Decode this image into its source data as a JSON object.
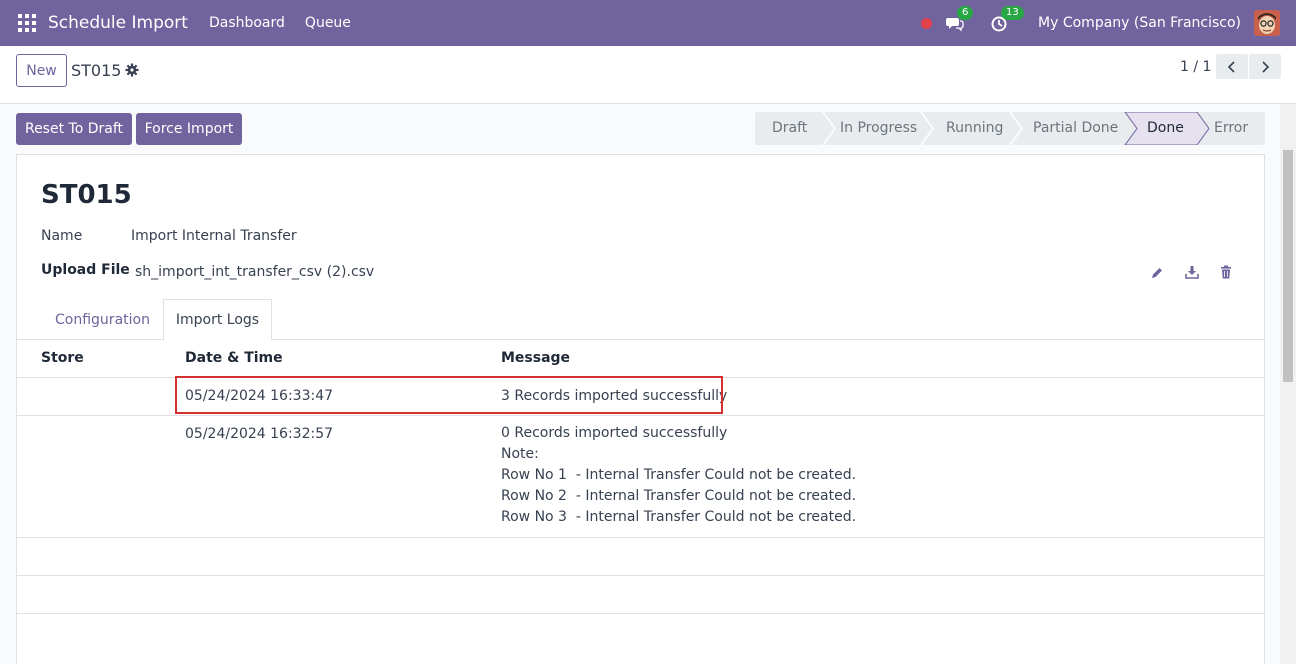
{
  "navbar": {
    "app_title": "Schedule Import",
    "links": [
      "Dashboard",
      "Queue"
    ],
    "messages_count": "6",
    "activities_count": "13",
    "company": "My Company (San Francisco)",
    "color": "#71639e"
  },
  "control": {
    "new_label": "New",
    "record_name": "ST015",
    "pager": "1 / 1"
  },
  "actions": {
    "reset_label": "Reset To Draft",
    "force_label": "Force Import"
  },
  "statusbar": {
    "steps": [
      "Draft",
      "In Progress",
      "Running",
      "Partial Done",
      "Done",
      "Error"
    ],
    "active": "Done"
  },
  "form": {
    "title": "ST015",
    "name_label": "Name",
    "name_value": "Import Internal Transfer",
    "file_label": "Upload File",
    "file_value": "sh_import_int_transfer_csv (2).csv"
  },
  "tabs": {
    "configuration": "Configuration",
    "import_logs": "Import Logs"
  },
  "table": {
    "headers": {
      "store": "Store",
      "datetime": "Date & Time",
      "message": "Message"
    },
    "rows": [
      {
        "store": "",
        "datetime": "05/24/2024 16:33:47",
        "message": [
          "3 Records imported successfully"
        ]
      },
      {
        "store": "",
        "datetime": "05/24/2024 16:32:57",
        "message": [
          "0 Records imported successfully",
          "Note:",
          "Row No 1  - Internal Transfer Could not be created.",
          "Row No 2  - Internal Transfer Could not be created.",
          "Row No 3  - Internal Transfer Could not be created."
        ]
      }
    ]
  }
}
